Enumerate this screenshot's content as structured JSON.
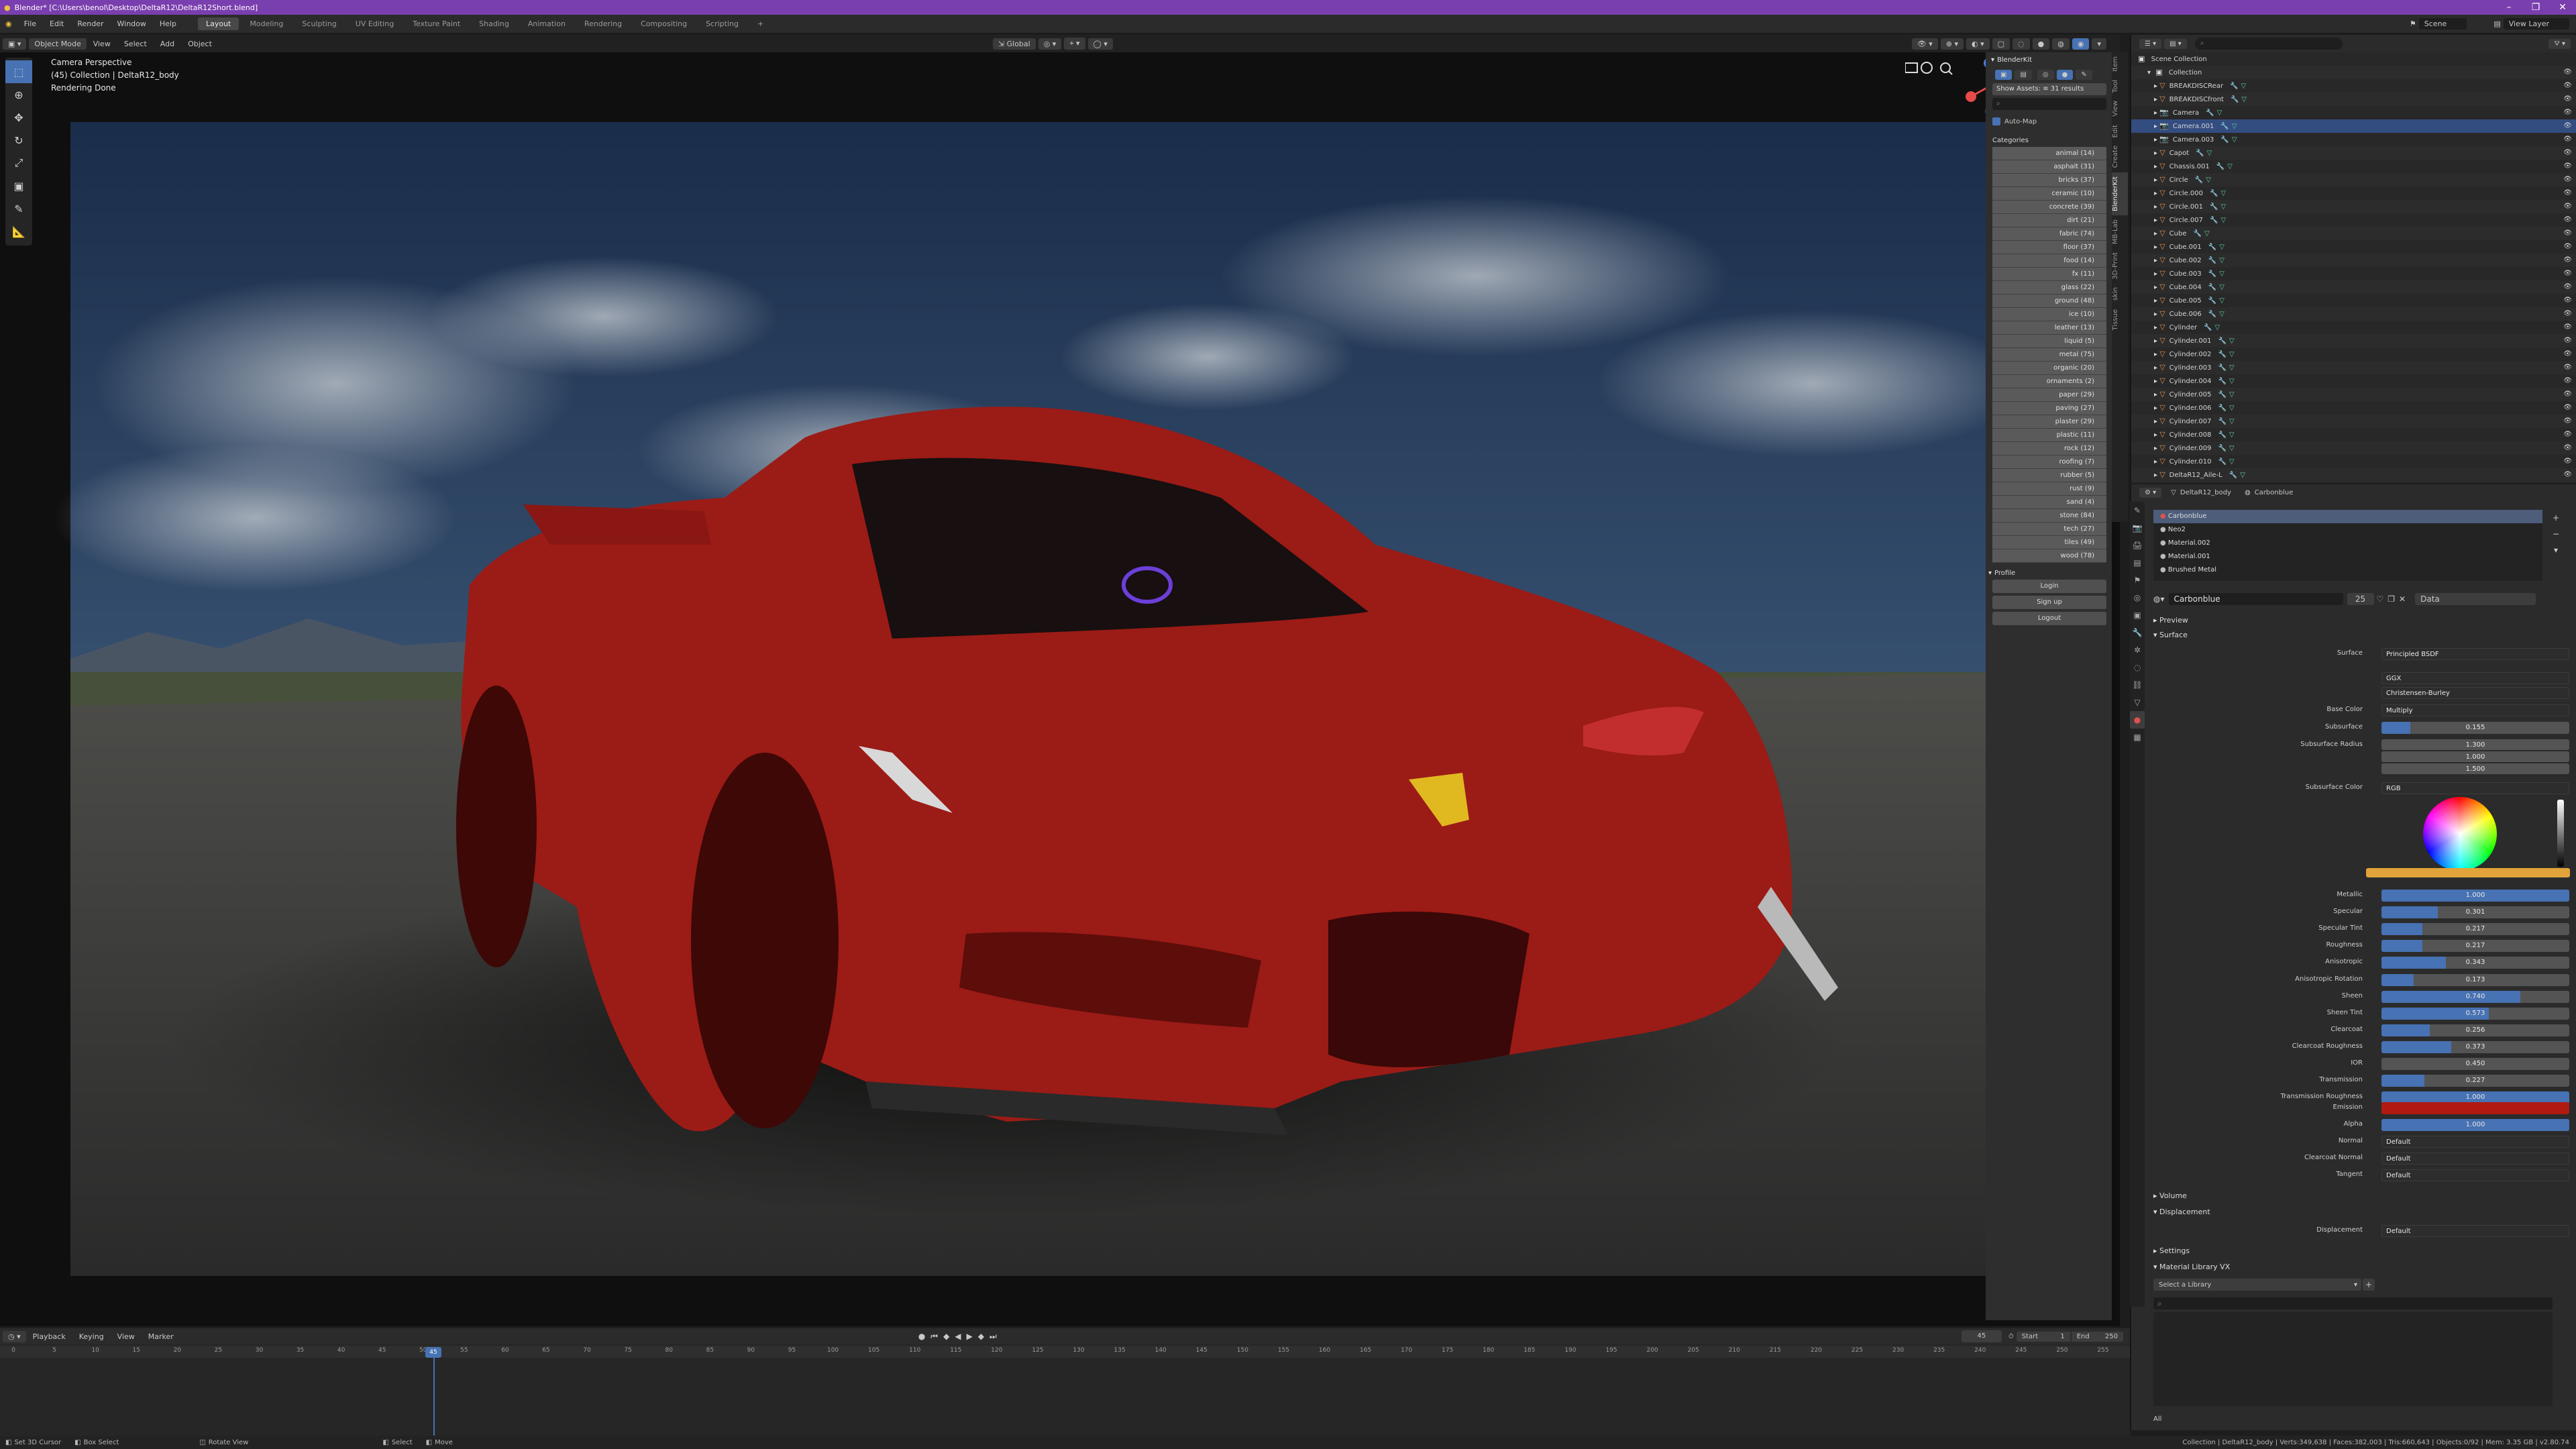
{
  "window": {
    "title": "Blender* [C:\\Users\\benol\\Desktop\\DeltaR12\\DeltaR12Short.blend]"
  },
  "topbar": {
    "menus": [
      "File",
      "Edit",
      "Render",
      "Window",
      "Help"
    ],
    "workspaces": [
      "Layout",
      "Modeling",
      "Sculpting",
      "UV Editing",
      "Texture Paint",
      "Shading",
      "Animation",
      "Rendering",
      "Compositing",
      "Scripting"
    ],
    "active_workspace": "Layout",
    "scene_label": "Scene",
    "view_layer_label": "View Layer"
  },
  "viewport": {
    "mode": "Object Mode",
    "menus": [
      "View",
      "Select",
      "Add",
      "Object"
    ],
    "transform_orientation": "Global",
    "overlay_lines": [
      "Camera Perspective",
      "(45) Collection | DeltaR12_body",
      "Rendering Done"
    ],
    "colors": {
      "car_body": "#9b1b16",
      "sky": "#2c4466",
      "ground": "#3a3a3a"
    }
  },
  "npanel": {
    "header": "BlenderKit",
    "search_info": "Show Assets: ≡ 31 results",
    "auto_map_label": "Auto-Map",
    "categories_label": "Categories",
    "categories": [
      "animal (14)",
      "asphalt (31)",
      "bricks (37)",
      "ceramic (10)",
      "concrete (39)",
      "dirt (21)",
      "fabric (74)",
      "floor (37)",
      "food (14)",
      "fx (11)",
      "glass (22)",
      "ground (48)",
      "ice (10)",
      "leather (13)",
      "liquid (5)",
      "metal (75)",
      "organic (20)",
      "ornaments (2)",
      "paper (29)",
      "paving (27)",
      "plaster (29)",
      "plastic (11)",
      "rock (12)",
      "roofing (7)",
      "rubber (5)",
      "rust (9)",
      "sand (4)",
      "stone (84)",
      "tech (27)",
      "tiles (49)",
      "wood (78)"
    ],
    "profile_label": "Profile",
    "profile_buttons": [
      "Login",
      "Sign up",
      "Logout"
    ],
    "tabs": [
      "Item",
      "Tool",
      "View",
      "Edit",
      "Create",
      "BlenderKit",
      "MB-Lab",
      "3D-Print",
      "skin",
      "Tissue"
    ]
  },
  "outliner": {
    "root": "Scene Collection",
    "collection": "Collection",
    "items": [
      "BREAKDISCRear",
      "BREAKDISCfront",
      "Camera",
      "Camera.001",
      "Camera.003",
      "Capot",
      "Chassis.001",
      "Circle",
      "Circle.000",
      "Circle.001",
      "Circle.007",
      "Cube",
      "Cube.001",
      "Cube.002",
      "Cube.003",
      "Cube.004",
      "Cube.005",
      "Cube.006",
      "Cylinder",
      "Cylinder.001",
      "Cylinder.002",
      "Cylinder.003",
      "Cylinder.004",
      "Cylinder.005",
      "Cylinder.006",
      "Cylinder.007",
      "Cylinder.008",
      "Cylinder.009",
      "Cylinder.010",
      "DeltaR12_Aile-L"
    ],
    "selected": "Camera.001"
  },
  "properties": {
    "breadcrumb_object": "DeltaR12_body",
    "breadcrumb_material": "Carbonblue",
    "material_slots": [
      "Carbonblue",
      "Neo2",
      "Material.002",
      "Material.001",
      "Brushed Metal"
    ],
    "material_name": "Carbonblue",
    "users": "25",
    "data_label": "Data",
    "sections": {
      "preview": "Preview",
      "surface": "Surface",
      "volume": "Volume",
      "displacement": "Displacement",
      "settings": "Settings",
      "material_library": "Material Library VX"
    },
    "surface_shader": "Principled BSDF",
    "distribution": "GGX",
    "subsurface_method": "Christensen-Burley",
    "base_color_value": "Multiply",
    "subsurface_color_value": "RGB",
    "subsurface_radius": [
      "1.300",
      "1.000",
      "1.500"
    ],
    "fields": [
      {
        "label": "Subsurface",
        "value": "0.155",
        "fraction": 0.155
      },
      {
        "label": "Metallic",
        "value": "1.000",
        "fraction": 1.0
      },
      {
        "label": "Specular",
        "value": "0.301",
        "fraction": 0.301
      },
      {
        "label": "Specular Tint",
        "value": "0.217",
        "fraction": 0.217
      },
      {
        "label": "Roughness",
        "value": "0.217",
        "fraction": 0.217
      },
      {
        "label": "Anisotropic",
        "value": "0.343",
        "fraction": 0.343
      },
      {
        "label": "Anisotropic Rotation",
        "value": "0.173",
        "fraction": 0.173
      },
      {
        "label": "Sheen",
        "value": "0.740",
        "fraction": 0.74
      },
      {
        "label": "Sheen Tint",
        "value": "0.573",
        "fraction": 0.573
      },
      {
        "label": "Clearcoat",
        "value": "0.256",
        "fraction": 0.256
      },
      {
        "label": "Clearcoat Roughness",
        "value": "0.373",
        "fraction": 0.373
      },
      {
        "label": "IOR",
        "value": "0.450",
        "fraction": 0
      },
      {
        "label": "Transmission",
        "value": "0.227",
        "fraction": 0.227
      },
      {
        "label": "Transmission Roughness",
        "value": "1.000",
        "fraction": 1.0
      }
    ],
    "emission_label": "Emission",
    "alpha": {
      "label": "Alpha",
      "value": "1.000",
      "fraction": 1.0
    },
    "normal_fields": [
      {
        "label": "Normal",
        "value": "Default"
      },
      {
        "label": "Clearcoat Normal",
        "value": "Default"
      },
      {
        "label": "Tangent",
        "value": "Default"
      }
    ],
    "displacement_field": {
      "label": "Displacement",
      "value": "Default"
    },
    "library_placeholder": "Select a Library",
    "library_filter": "All",
    "colors": {
      "subsurface_color": "#e1a33a",
      "emission_color": "#b01a10"
    }
  },
  "timeline": {
    "menus": [
      "Playback",
      "Keying",
      "View",
      "Marker"
    ],
    "current_frame": "45",
    "start_label": "Start",
    "start": "1",
    "end_label": "End",
    "end": "250",
    "ticks": [
      "0",
      "5",
      "10",
      "15",
      "20",
      "25",
      "30",
      "35",
      "40",
      "45",
      "50",
      "55",
      "60",
      "65",
      "70",
      "75",
      "80",
      "85",
      "90",
      "95",
      "100",
      "105",
      "110",
      "115",
      "120",
      "125",
      "130",
      "135",
      "140",
      "145",
      "150",
      "155",
      "160",
      "165",
      "170",
      "175",
      "180",
      "185",
      "190",
      "195",
      "200",
      "205",
      "210",
      "215",
      "220",
      "225",
      "230",
      "235",
      "240",
      "245",
      "250",
      "255"
    ]
  },
  "statusbar": {
    "hints": [
      "Set 3D Cursor",
      "Box Select",
      "Rotate View",
      "Select",
      "Move"
    ],
    "stats": "Collection | DeltaR12_body | Verts:349,638 | Faces:382,003 | Tris:660,643 | Objects:0/92 | Mem: 3.35 GB | v2.80.74"
  }
}
